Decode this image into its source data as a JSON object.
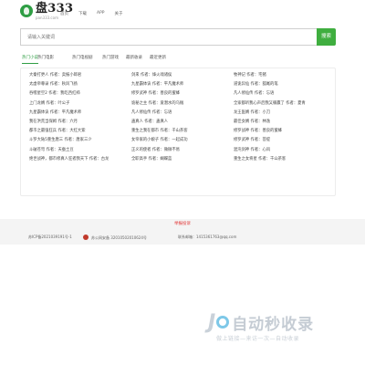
{
  "header": {
    "logo_title": "盘333",
    "logo_sub": "pan333.com",
    "nav": [
      "首页",
      "下载",
      "APP",
      "关于"
    ]
  },
  "search": {
    "placeholder": "请输入关键词",
    "button_label": "搜索"
  },
  "tabs": [
    {
      "label": "热门小说",
      "active": true
    },
    {
      "label": "热门电影",
      "active": false
    },
    {
      "label": "热门电视剧",
      "active": false
    },
    {
      "label": "热门游戏",
      "active": false
    },
    {
      "label": "最新收录",
      "active": false
    },
    {
      "label": "最近更新",
      "active": false
    }
  ],
  "list": {
    "col1": [
      "大秦打更人 作者：卖报小郎君",
      "太虚帝尊录 作者：秋风飞扬",
      "吞噬星空2 作者：我吃西红柿",
      "上门龙婿 作者：叶公子",
      "九星霸体诀 作者：平凡魔术师",
      "我在洪荒当保姆 作者：六月",
      "都市之最强狂兵 作者：大红大紫",
      "斗罗大陆5重生唐三 作者：唐家三少",
      "斗破苍穹 作者：天蚕土豆",
      "绝世战神，都市修真人狂者我天下 作者：古龙"
    ],
    "col2": [
      "剑来 作者：烽火戏诸侯",
      "九星霸体诀 作者：平凡魔术师",
      "修罗武神 作者：善良的蜜蜂",
      "诡秘之主 作者：爱潜水的乌贼",
      "凡人修仙传 作者：忘语",
      "蛊真人 作者：蛊真人",
      "重生之我在都市 作者：千山茶客",
      "女帝家的小娘子 作者：一起成功",
      "正义的使者 作者：微微不易",
      "全职高手 作者：蝴蝶蓝"
    ],
    "col3": [
      "牧神记 作者：宅猪",
      "道诡异仙 作者：狐尾的笔",
      "凡人修仙传 作者：忘语",
      "全家都听我心声后我又躺赢了 作者：夏青",
      "龙王医婿 作者：小刀",
      "最佳女婿 作者：林逸",
      "修罗战神 作者：善良的蜜蜂",
      "修罗武神 作者：菩提",
      "混沌剑神 作者：心风",
      "重生之女将星 作者：千山茶客"
    ]
  },
  "footer": {
    "report": "举报投诉",
    "icp": "苏ICP备2021039191号-1",
    "police": "苏公网安备 32010502010624号",
    "contact": "联系邮箱：1415361763@qq.com"
  },
  "watermark": {
    "title": "自动秒收录",
    "slogan": "做上链接—来访一次—自动收录"
  }
}
